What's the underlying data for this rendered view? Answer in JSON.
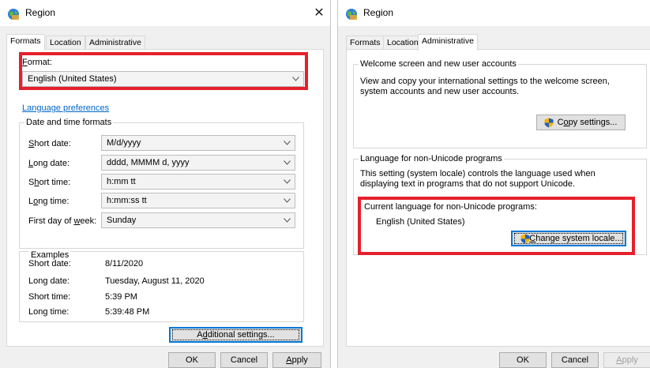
{
  "left_dialog": {
    "title": "Region",
    "close_glyph": "✕",
    "tabs": [
      {
        "label": "Formats",
        "active": true
      },
      {
        "label": "Location",
        "active": false
      },
      {
        "label": "Administrative",
        "active": false
      }
    ],
    "format_label_first": "F",
    "format_label_rest": "ormat:",
    "format_value": "English (United States)",
    "language_prefs_link": "Language preferences",
    "date_time_group": "Date and time formats",
    "rows": [
      {
        "label_pre": "",
        "label_u": "S",
        "label_post": "hort date:",
        "value": "M/d/yyyy"
      },
      {
        "label_pre": "",
        "label_u": "L",
        "label_post": "ong date:",
        "value": "dddd, MMMM d, yyyy"
      },
      {
        "label_pre": "S",
        "label_u": "h",
        "label_post": "ort time:",
        "value": "h:mm tt"
      },
      {
        "label_pre": "L",
        "label_u": "o",
        "label_post": "ng time:",
        "value": "h:mm:ss tt"
      },
      {
        "label_pre": "First day of ",
        "label_u": "w",
        "label_post": "eek:",
        "value": "Sunday"
      }
    ],
    "examples_group": "Examples",
    "examples": [
      {
        "label": "Short date:",
        "value": "8/11/2020"
      },
      {
        "label": "Long date:",
        "value": "Tuesday, August 11, 2020"
      },
      {
        "label": "Short time:",
        "value": "5:39 PM"
      },
      {
        "label": "Long time:",
        "value": "5:39:48 PM"
      }
    ],
    "additional_pre": "A",
    "additional_u": "d",
    "additional_post": "ditional settings...",
    "ok": "OK",
    "cancel": "Cancel",
    "apply_u": "A",
    "apply_rest": "pply"
  },
  "right_dialog": {
    "title": "Region",
    "tabs": [
      {
        "label": "Formats",
        "active": false
      },
      {
        "label": "Location",
        "active": false
      },
      {
        "label": "Administrative",
        "active": true
      }
    ],
    "welcome_group": "Welcome screen and new user accounts",
    "welcome_text": "View and copy your international settings to the welcome screen, system accounts and new user accounts.",
    "copy_pre": "C",
    "copy_u": "o",
    "copy_post": "py settings...",
    "nonunicode_group": "Language for non-Unicode programs",
    "nonunicode_text": "This setting (system locale) controls the language used when displaying text in programs that do not support Unicode.",
    "current_label": "Current language for non-Unicode programs:",
    "current_value": "English (United States)",
    "change_u": "C",
    "change_rest": "hange system locale...",
    "ok": "OK",
    "cancel": "Cancel",
    "apply_u": "A",
    "apply_rest": "pply"
  },
  "colors": {
    "highlight": "#e5202c",
    "link": "#0066cc",
    "focus": "#0078d7"
  },
  "icons": {
    "title": "globe-icon",
    "shield": "uac-shield-icon"
  }
}
